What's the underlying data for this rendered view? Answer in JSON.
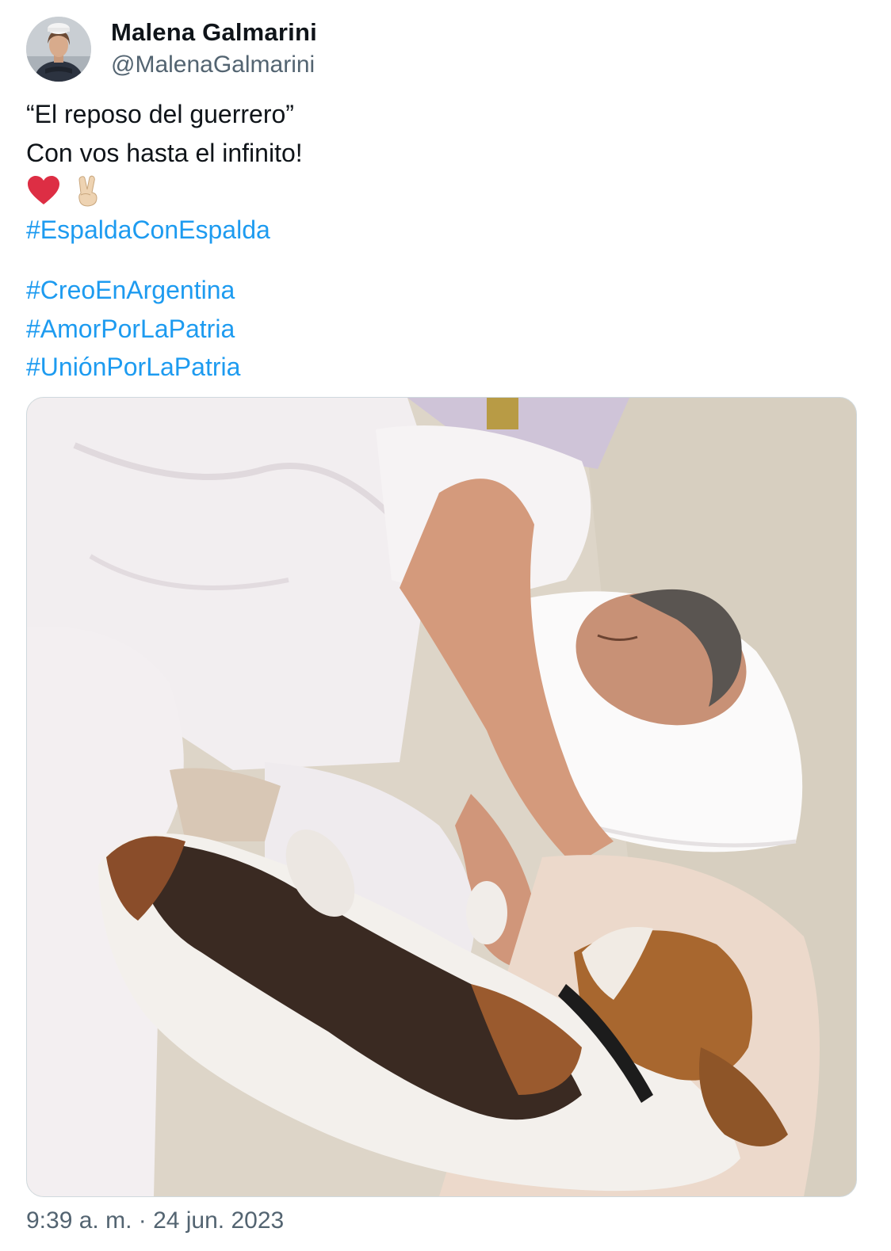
{
  "author": {
    "display_name": "Malena Galmarini",
    "handle": "@MalenaGalmarini",
    "avatar_icon": "profile-photo"
  },
  "tweet": {
    "line1": "“El reposo del guerrero”",
    "line2": "Con vos hasta el infinito!",
    "emojis": [
      "red-heart-icon",
      "victory-hand-icon"
    ],
    "hashtags": [
      "#EspaldaConEspalda",
      "#CreoEnArgentina",
      "#AmorPorLaPatria",
      "#UniónPorLaPatria"
    ]
  },
  "media": {
    "image_icon": "photo-man-sleeping-with-beagle"
  },
  "timestamp": "9:39 a. m. · 24 jun. 2023",
  "colors": {
    "text": "#0f1419",
    "secondary": "#536471",
    "link": "#1d9bf0"
  }
}
